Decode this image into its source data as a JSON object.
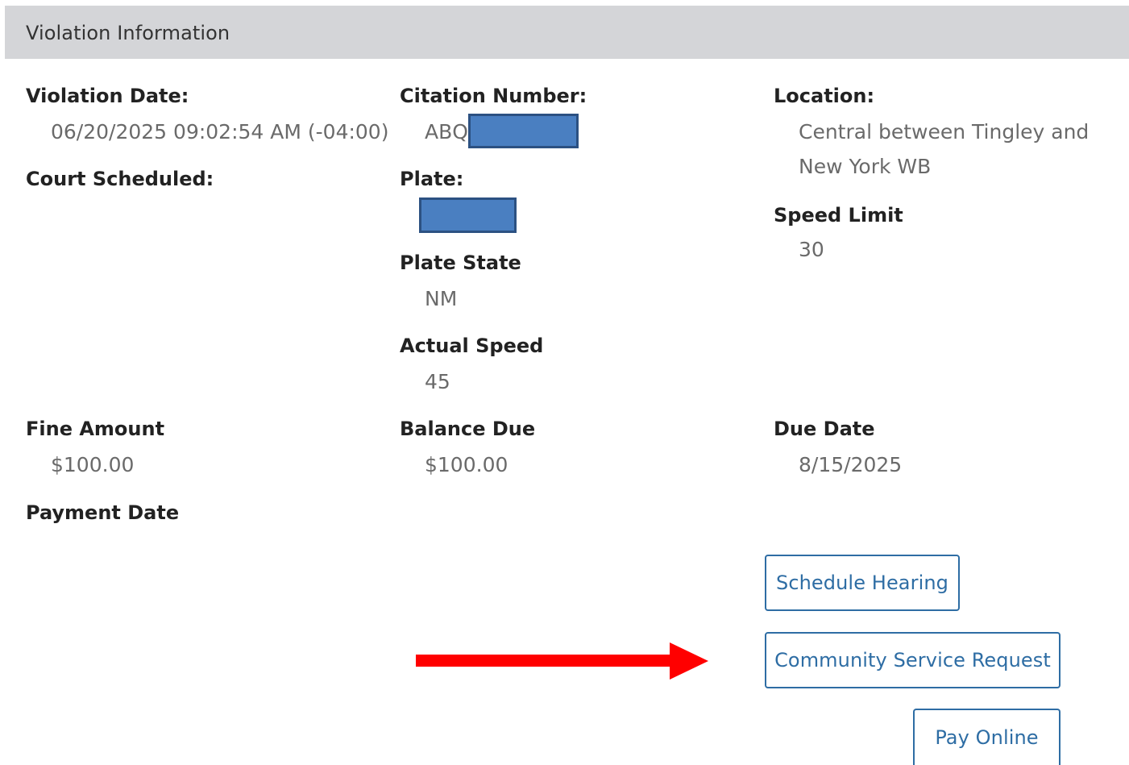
{
  "panel": {
    "title": "Violation Information"
  },
  "fields": {
    "violation_date": {
      "label": "Violation Date:",
      "value": "06/20/2025 09:02:54 AM (-04:00)"
    },
    "citation_number": {
      "label": "Citation Number:",
      "value_prefix": "ABQ"
    },
    "location": {
      "label": "Location:",
      "value_line1": "Central between Tingley and",
      "value_line2": "New York WB"
    },
    "court_scheduled": {
      "label": "Court Scheduled:"
    },
    "plate": {
      "label": "Plate:"
    },
    "plate_state": {
      "label": "Plate State",
      "value": "NM"
    },
    "speed_limit": {
      "label": "Speed Limit",
      "value": "30"
    },
    "actual_speed": {
      "label": "Actual Speed",
      "value": "45"
    },
    "fine_amount": {
      "label": "Fine Amount",
      "value": "$100.00"
    },
    "balance_due": {
      "label": "Balance Due",
      "value": "$100.00"
    },
    "due_date": {
      "label": "Due Date",
      "value": "8/15/2025"
    },
    "payment_date": {
      "label": "Payment Date"
    }
  },
  "actions": {
    "schedule_hearing": "Schedule Hearing",
    "community_service_request": "Community Service Request",
    "pay_online": "Pay Online"
  },
  "colors": {
    "header_bg": "#d4d5d8",
    "button_accent": "#2e6da4",
    "redaction_fill": "#4a7fc1",
    "annotation_arrow": "#ff0000"
  }
}
